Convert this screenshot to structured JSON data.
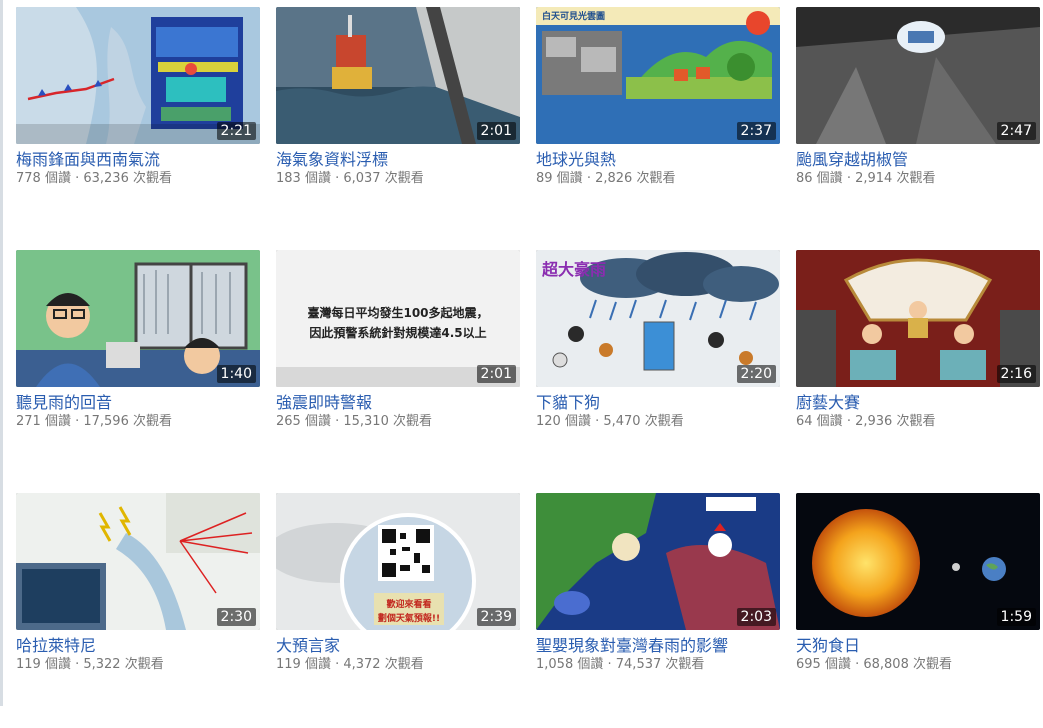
{
  "videos": [
    {
      "title": "梅雨鋒面與西南氣流",
      "duration": "2:21",
      "likes": "778 個讚",
      "views": "63,236 次觀看"
    },
    {
      "title": "海氣象資料浮標",
      "duration": "2:01",
      "likes": "183 個讚",
      "views": "6,037 次觀看"
    },
    {
      "title": "地球光與熱",
      "duration": "2:37",
      "likes": "89 個讚",
      "views": "2,826 次觀看",
      "overlay": "白天可見光雲圖"
    },
    {
      "title": "颱風穿越胡椒管",
      "duration": "2:47",
      "likes": "86 個讚",
      "views": "2,914 次觀看"
    },
    {
      "title": "聽見雨的回音",
      "duration": "1:40",
      "likes": "271 個讚",
      "views": "17,596 次觀看"
    },
    {
      "title": "強震即時警報",
      "duration": "2:01",
      "likes": "265 個讚",
      "views": "15,310 次觀看",
      "overlay_line1": "臺灣每日平均發生100多起地震，",
      "overlay_line2": "因此預警系統針對規模達4.5以上"
    },
    {
      "title": "下貓下狗",
      "duration": "2:20",
      "likes": "120 個讚",
      "views": "5,470 次觀看",
      "overlay": "超大豪雨"
    },
    {
      "title": "廚藝大賽",
      "duration": "2:16",
      "likes": "64 個讚",
      "views": "2,936 次觀看"
    },
    {
      "title": "哈拉萊特尼",
      "duration": "2:30",
      "likes": "119 個讚",
      "views": "5,322 次觀看"
    },
    {
      "title": "大預言家",
      "duration": "2:39",
      "likes": "119 個讚",
      "views": "4,372 次觀看",
      "overlay_line1": "歡迎來看看",
      "overlay_line2": "劃個天氣預報!!"
    },
    {
      "title": "聖嬰現象對臺灣春雨的影響",
      "duration": "2:03",
      "likes": "1,058 個讚",
      "views": "74,537 次觀看"
    },
    {
      "title": "天狗食日",
      "duration": "1:59",
      "likes": "695 個讚",
      "views": "68,808 次觀看"
    }
  ],
  "meta_separator": " · "
}
